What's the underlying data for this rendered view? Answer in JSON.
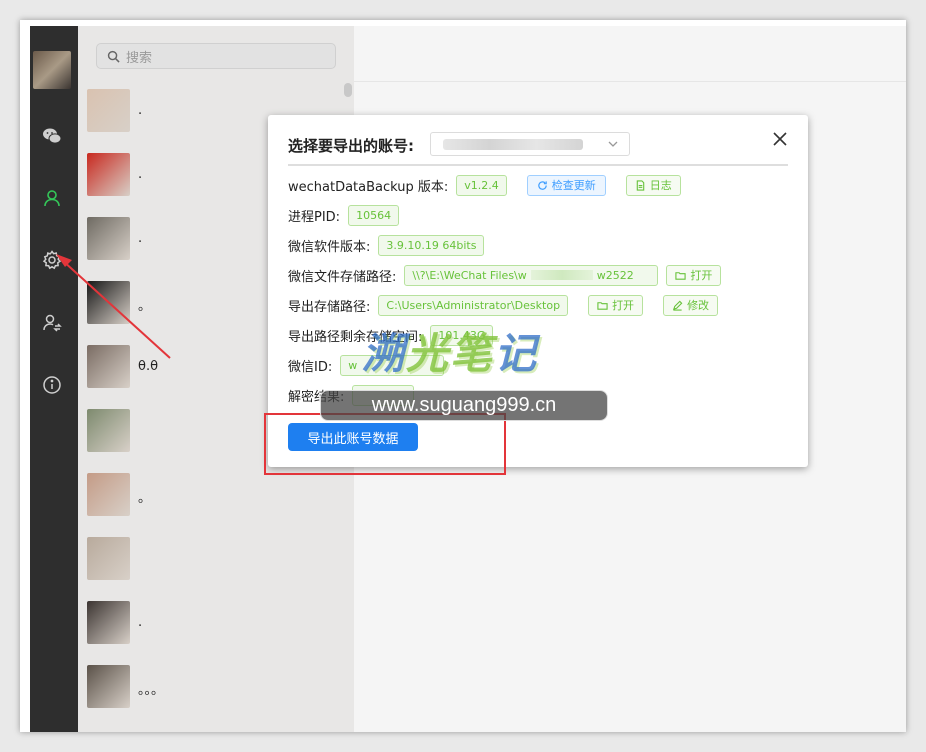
{
  "search": {
    "placeholder": "搜索"
  },
  "chats": [
    {
      "name": ".",
      "color": "#d9c2b0"
    },
    {
      "name": ".",
      "color": "#c8281e"
    },
    {
      "name": ".",
      "color": "#6e6a62"
    },
    {
      "name": "。",
      "color": "#161616"
    },
    {
      "name": "θ.θ",
      "color": "#7a6c63"
    },
    {
      "name": "",
      "color": "#7d8a6e"
    },
    {
      "name": "。",
      "color": "#c49b86"
    },
    {
      "name": "",
      "color": "#b8aa9c"
    },
    {
      "name": ".",
      "color": "#3b3431"
    },
    {
      "name": "。。。",
      "color": "#5a5148"
    }
  ],
  "dialog": {
    "title": "选择要导出的账号:",
    "version_label": "wechatDataBackup 版本:",
    "version_value": "v1.2.4",
    "check_update": "检查更新",
    "log": "日志",
    "pid_label": "进程PID:",
    "pid_value": "10564",
    "wx_version_label": "微信软件版本:",
    "wx_version_value": "3.9.10.19 64bits",
    "wx_path_label": "微信文件存储路径:",
    "wx_path_value": "\\\\?\\E:\\WeChat Files\\w",
    "wx_path_tail": "w2522",
    "open": "打开",
    "export_path_label": "导出存储路径:",
    "export_path_value": "C:\\Users\\Administrator\\Desktop",
    "modify": "修改",
    "free_space_label": "导出路径剩余存储空间:",
    "free_space_value": "101.43G",
    "wxid_label": "微信ID:",
    "wxid_value": "w",
    "decrypt_label": "解密结果:",
    "export_button": "导出此账号数据"
  },
  "watermark": {
    "logo": [
      "溯",
      "光",
      "笔",
      "记"
    ],
    "url": "www.suguang999.cn"
  }
}
